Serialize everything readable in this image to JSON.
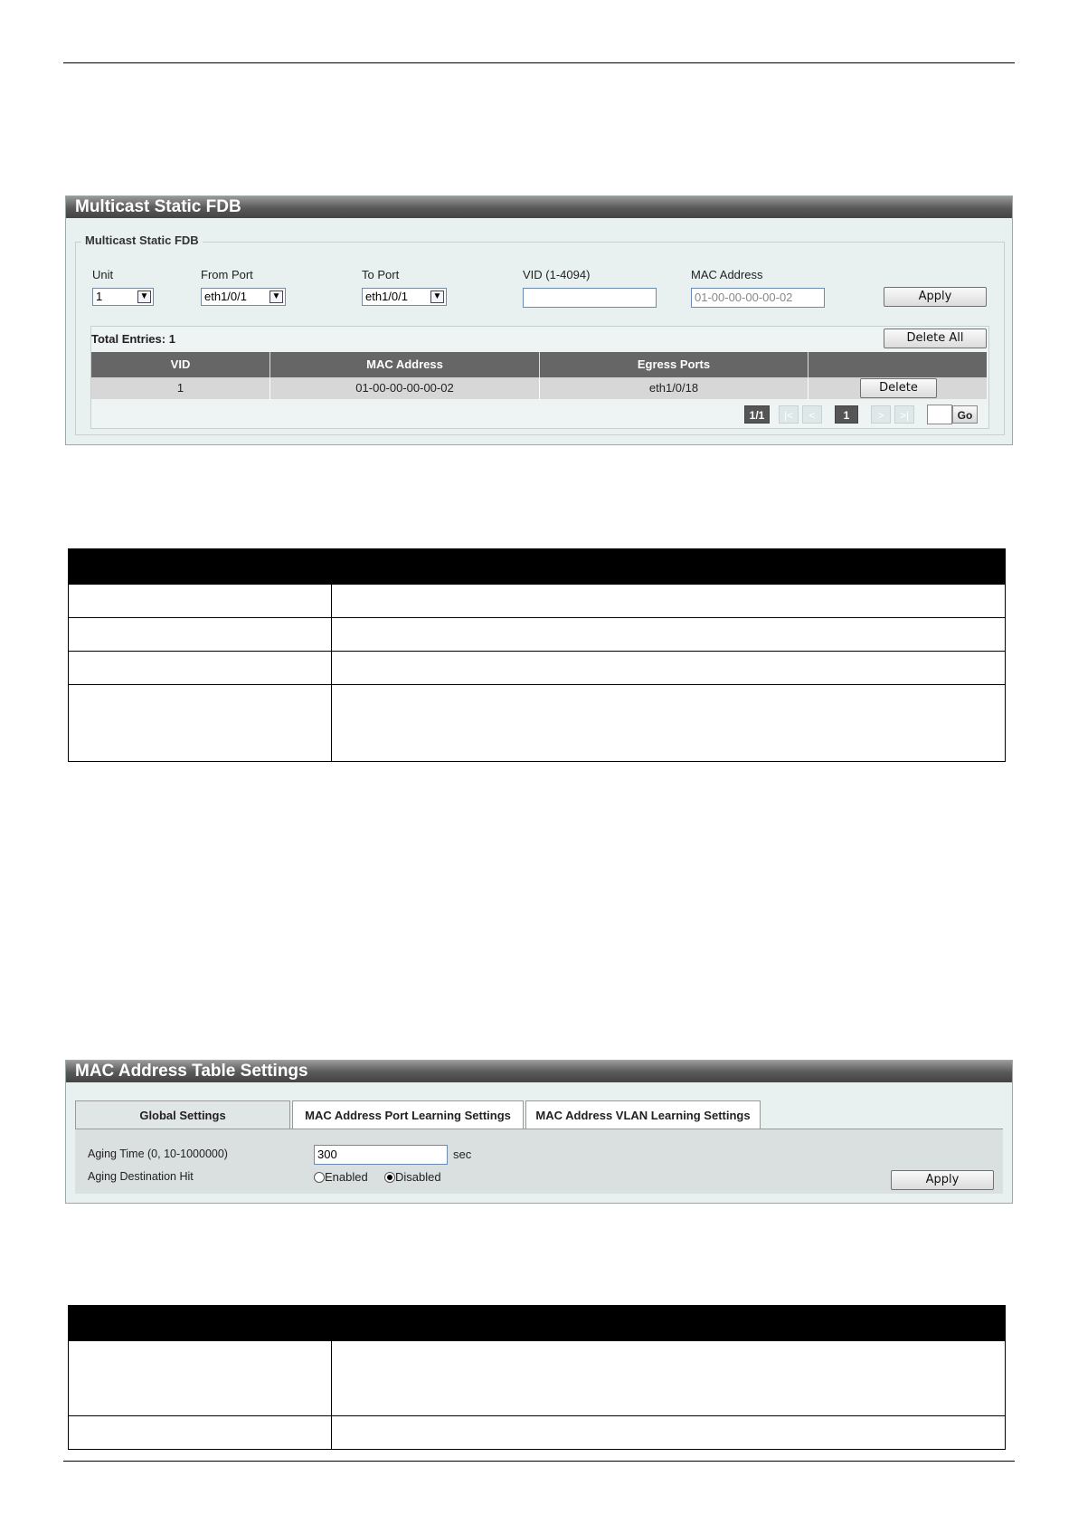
{
  "fdb_panel": {
    "title": "Multicast Static FDB",
    "legend": "Multicast Static FDB",
    "fields": {
      "unit_label": "Unit",
      "unit_value": "1",
      "from_port_label": "From Port",
      "from_port_value": "eth1/0/1",
      "to_port_label": "To Port",
      "to_port_value": "eth1/0/1",
      "vid_label": "VID (1-4094)",
      "vid_value": "",
      "mac_label": "MAC Address",
      "mac_placeholder": "01-00-00-00-00-02"
    },
    "apply_label": "Apply",
    "total_entries": "Total Entries: 1",
    "delete_all_label": "Delete All",
    "table": {
      "headers": [
        "VID",
        "MAC Address",
        "Egress Ports",
        ""
      ],
      "rows": [
        {
          "vid": "1",
          "mac": "01-00-00-00-00-02",
          "ports": "eth1/0/18",
          "action": "Delete"
        }
      ]
    },
    "pagination": {
      "page_info": "1/1",
      "first": "|<",
      "prev": "<",
      "current": "1",
      "next": ">",
      "last": ">|",
      "go_label": "Go"
    }
  },
  "mac_panel": {
    "title": "MAC Address Table Settings",
    "tabs": [
      "Global Settings",
      "MAC Address Port Learning Settings",
      "MAC Address VLAN Learning Settings"
    ],
    "aging_time_label": "Aging Time (0, 10-1000000)",
    "aging_time_value": "300",
    "aging_time_unit": "sec",
    "aging_hit_label": "Aging Destination Hit",
    "enabled_label": "Enabled",
    "disabled_label": "Disabled",
    "aging_hit_value": "Disabled",
    "apply_label": "Apply"
  }
}
